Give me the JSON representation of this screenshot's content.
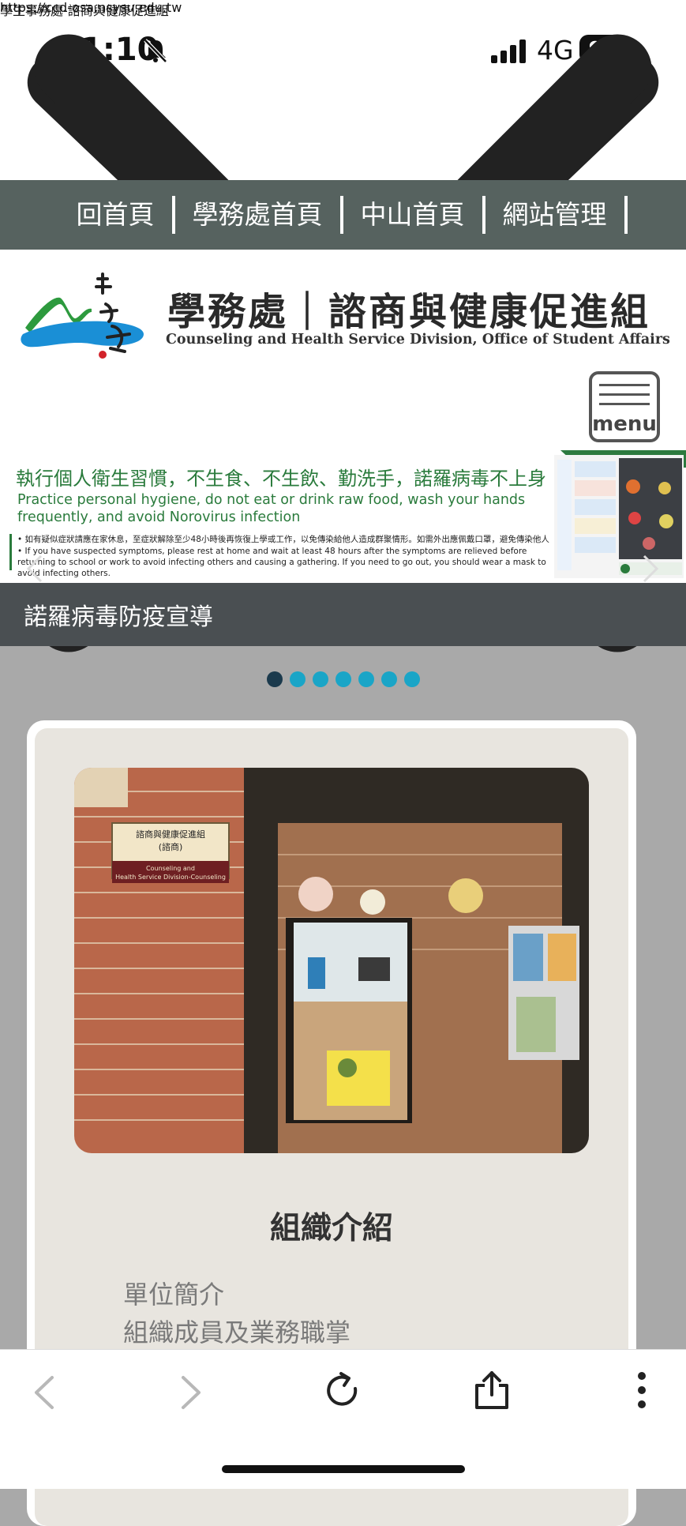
{
  "status_bar": {
    "time": "1:10",
    "network": "4G",
    "battery": "96"
  },
  "browser": {
    "title": "學生事務處-諮商與健康促進組",
    "url": "https://ccd-osa.nsysu.edu.tw"
  },
  "top_nav": {
    "items": [
      "回首頁",
      "學務處首頁",
      "中山首頁",
      "網站管理"
    ]
  },
  "site": {
    "title": "學務處｜諮商與健康促進組",
    "subtitle": "Counseling and Health Service Division, Office of Student Affairs",
    "menu_label": "menu"
  },
  "banner": {
    "heading_zh": "執行個人衛生習慣，不生食、不生飲、勤洗手，諾羅病毒不上身",
    "heading_en": "Practice personal hygiene, do not eat or drink raw food, wash your hands frequently, and avoid Norovirus infection",
    "bullet_zh": "• 如有疑似症狀請應在家休息，至症狀解除至少48小時後再恢復上學或工作，以免傳染給他人造成群聚情形。如需外出應佩戴口罩，避免傳染他人",
    "bullet_en": "• If you have suspected symptoms, please rest at home and wait at least 48 hours after the symptoms are relieved before returning to school or work to avoid infecting others and causing a gathering. If you need to go out, you should wear a mask to avoid infecting others.",
    "tab_char": "o",
    "caption": "諾羅病毒防疫宣導",
    "slide_count": 7,
    "active_slide": 1
  },
  "card": {
    "section_title": "組織介紹",
    "links": [
      "單位簡介",
      "組織成員及業務職掌"
    ],
    "photo_sign": {
      "line1": "諮商與健康促進組",
      "line2": "(諮商)",
      "line3": "Counseling and",
      "line4": "Health Service Division-Counseling"
    }
  },
  "colors": {
    "nav_bg": "#56625f",
    "caption_bg": "#4a4f52",
    "dot": "#1aa5c7",
    "dot_active": "#1b3a4d",
    "green": "#2a7b3c"
  }
}
